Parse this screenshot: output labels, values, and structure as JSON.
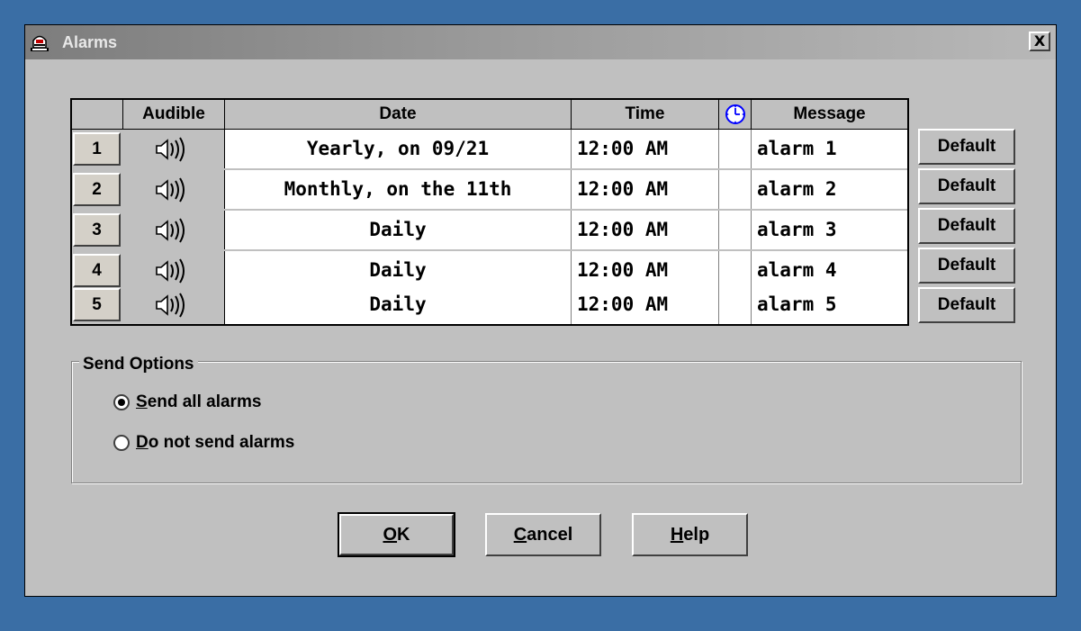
{
  "window": {
    "title": "Alarms",
    "close_label": "X"
  },
  "table": {
    "headers": {
      "audible": "Audible",
      "date": "Date",
      "time": "Time",
      "message": "Message"
    },
    "rows": [
      {
        "num": "1",
        "date": "Yearly, on 09/21",
        "time": "12:00 AM",
        "message": "alarm 1",
        "default_label": "Default"
      },
      {
        "num": "2",
        "date": "Monthly, on the 11th",
        "time": "12:00 AM",
        "message": "alarm 2",
        "default_label": "Default"
      },
      {
        "num": "3",
        "date": "Daily",
        "time": "12:00 AM",
        "message": "alarm 3",
        "default_label": "Default"
      },
      {
        "num": "4",
        "date": "Daily",
        "time": "12:00 AM",
        "message": "alarm 4",
        "default_label": "Default"
      },
      {
        "num": "5",
        "date": "Daily",
        "time": "12:00 AM",
        "message": "alarm 5",
        "default_label": "Default"
      }
    ]
  },
  "send_options": {
    "label": "Send Options",
    "options": [
      {
        "accel": "S",
        "rest": "end all alarms",
        "selected": true
      },
      {
        "accel": "D",
        "rest": "o not send alarms",
        "selected": false
      }
    ]
  },
  "buttons": {
    "ok": {
      "accel": "O",
      "rest": "K"
    },
    "cancel": {
      "accel": "C",
      "rest": "ancel"
    },
    "help": {
      "accel": "H",
      "rest": "elp"
    }
  },
  "icons": {
    "title": "alarm-bell-icon",
    "speaker": "speaker-icon",
    "clock": "clock-icon"
  },
  "colors": {
    "desktop": "#3a6ea5",
    "dialog": "#c0c0c0",
    "clock_accent": "#0000ff"
  }
}
